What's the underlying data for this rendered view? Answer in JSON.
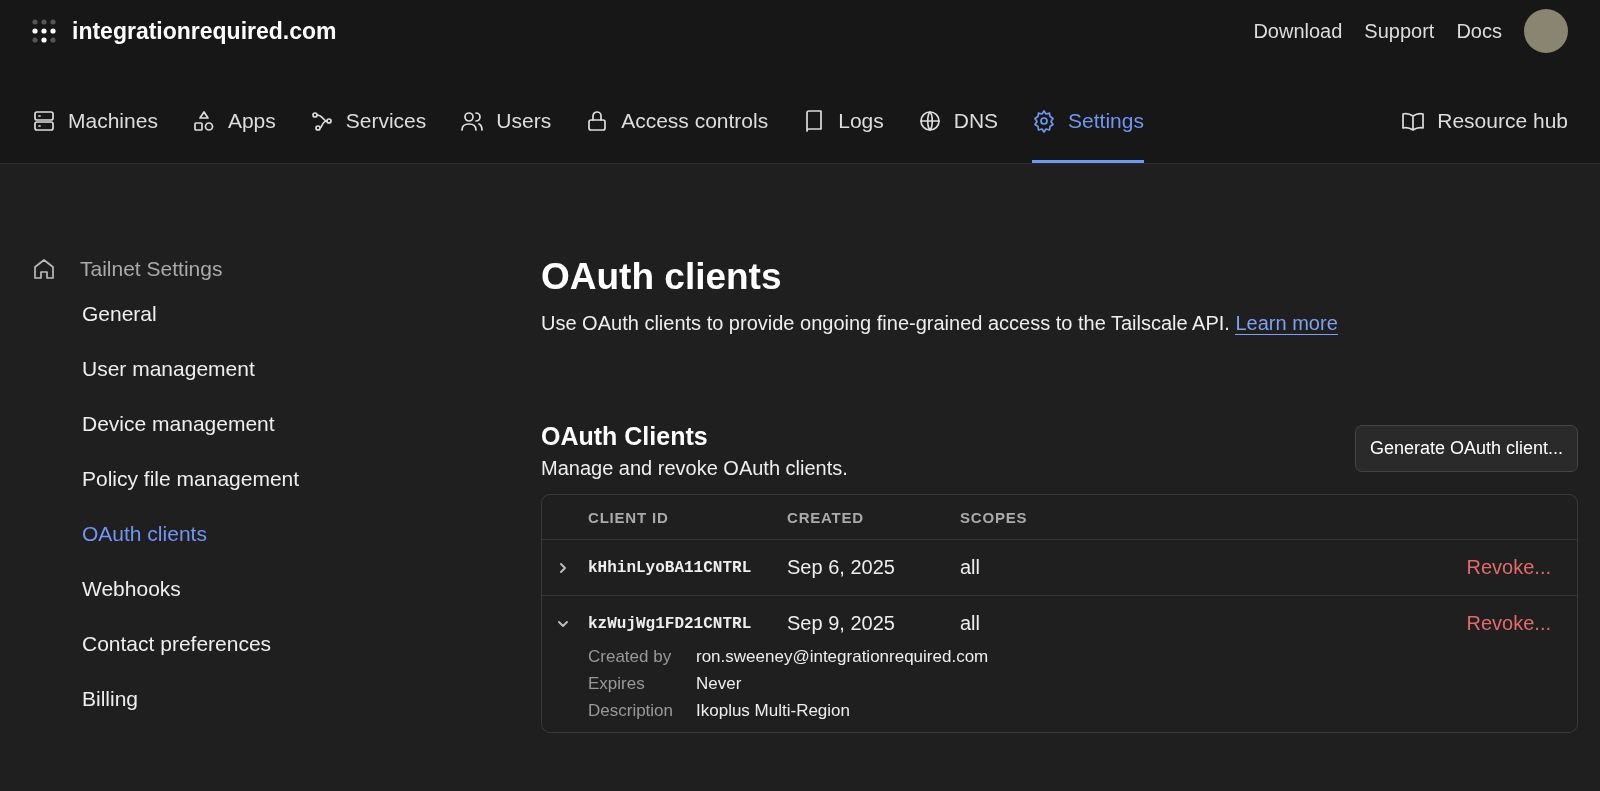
{
  "brand": {
    "name": "integrationrequired.com"
  },
  "top_links": [
    "Download",
    "Support",
    "Docs"
  ],
  "nav": {
    "items": [
      {
        "label": "Machines",
        "selected": false
      },
      {
        "label": "Apps",
        "selected": false
      },
      {
        "label": "Services",
        "selected": false
      },
      {
        "label": "Users",
        "selected": false
      },
      {
        "label": "Access controls",
        "selected": false
      },
      {
        "label": "Logs",
        "selected": false
      },
      {
        "label": "DNS",
        "selected": false
      },
      {
        "label": "Settings",
        "selected": true
      }
    ],
    "resource_link": "Resource hub"
  },
  "sidebar": {
    "title": "Tailnet Settings",
    "items": [
      {
        "label": "General",
        "selected": false
      },
      {
        "label": "User management",
        "selected": false
      },
      {
        "label": "Device management",
        "selected": false
      },
      {
        "label": "Policy file management",
        "selected": false
      },
      {
        "label": "OAuth clients",
        "selected": true
      },
      {
        "label": "Webhooks",
        "selected": false
      },
      {
        "label": "Contact preferences",
        "selected": false
      },
      {
        "label": "Billing",
        "selected": false
      }
    ]
  },
  "page": {
    "title": "OAuth clients",
    "description": "Use OAuth clients to provide ongoing fine-grained access to the Tailscale API.",
    "learn_more": "Learn more"
  },
  "section": {
    "title": "OAuth Clients",
    "subtitle": "Manage and revoke OAuth clients.",
    "button": "Generate OAuth client..."
  },
  "table": {
    "columns": [
      "CLIENT ID",
      "CREATED",
      "SCOPES"
    ],
    "rows": [
      {
        "client_id": "kHhinLyoBA11CNTRL",
        "created": "Sep 6, 2025",
        "scopes": "all",
        "action": "Revoke...",
        "expanded": false,
        "details": []
      },
      {
        "client_id": "kzWujWg1FD21CNTRL",
        "created": "Sep 9, 2025",
        "scopes": "all",
        "action": "Revoke...",
        "expanded": true,
        "details": [
          {
            "label": "Created by",
            "value": "ron.sweeney@integrationrequired.com"
          },
          {
            "label": "Expires",
            "value": "Never"
          },
          {
            "label": "Description",
            "value": "Ikoplus Multi-Region"
          }
        ]
      }
    ]
  }
}
